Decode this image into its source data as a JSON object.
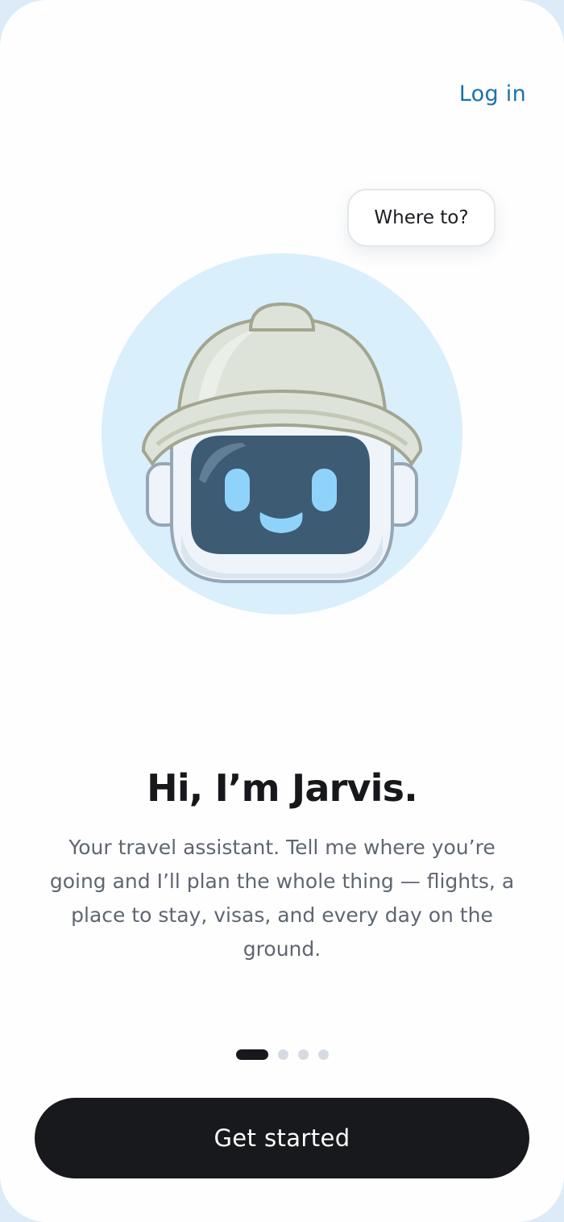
{
  "header": {
    "login_label": "Log in"
  },
  "bubble": {
    "text": "Where to?"
  },
  "onboarding": {
    "title": "Hi, I’m Jarvis.",
    "description": "Your travel assistant. Tell me where you’re going and I’ll plan the whole thing — flights, a place to stay, visas, and every day on the ground.",
    "current_page": 1,
    "total_pages": 4
  },
  "cta": {
    "label": "Get started"
  },
  "colors": {
    "accent": "#1a73a8",
    "primary_button": "#18191d",
    "avatar_background": "#d9effc",
    "robot_face": "#3d5b73",
    "robot_eyes": "#8fd3fb"
  },
  "icons": {
    "avatar": "robot-safari-helmet-icon"
  }
}
